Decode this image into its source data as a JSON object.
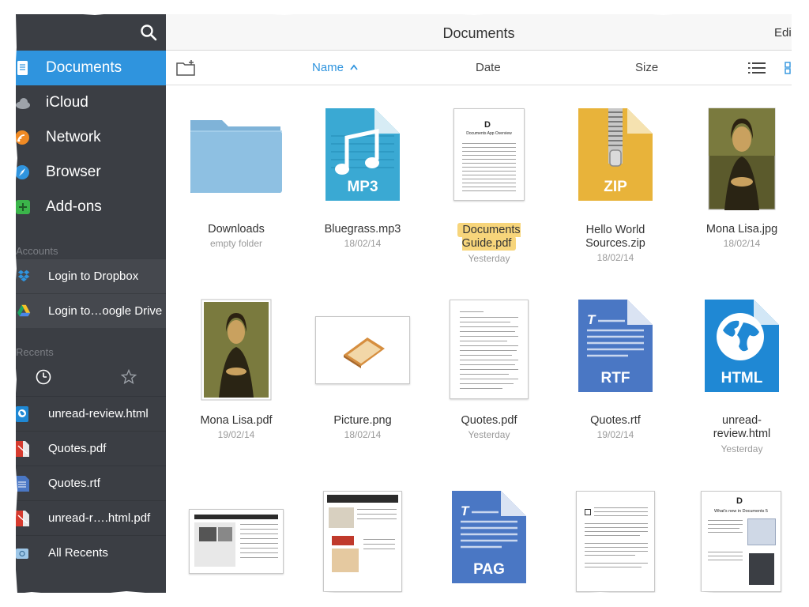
{
  "header": {
    "title": "Documents",
    "edit_label": "Edi"
  },
  "sidebar": {
    "items": [
      {
        "label": "Documents",
        "icon": "documents-icon",
        "active": true
      },
      {
        "label": "iCloud",
        "icon": "cloud-icon"
      },
      {
        "label": "Network",
        "icon": "network-icon"
      },
      {
        "label": "Browser",
        "icon": "compass-icon"
      },
      {
        "label": "Add-ons",
        "icon": "add-ons-icon"
      }
    ],
    "accounts_header": "Accounts",
    "accounts": [
      {
        "label": "Login to Dropbox",
        "icon": "dropbox-icon"
      },
      {
        "label": "Login to…oogle Drive",
        "icon": "google-drive-icon"
      }
    ],
    "recents_header": "Recents",
    "recents_tabs": [
      {
        "icon": "clock-icon"
      },
      {
        "icon": "star-icon"
      }
    ],
    "recents": [
      {
        "label": "unread-review.html",
        "icon": "html-file-icon"
      },
      {
        "label": "Quotes.pdf",
        "icon": "pdf-file-icon"
      },
      {
        "label": "Quotes.rtf",
        "icon": "rtf-file-icon"
      },
      {
        "label": "unread-r….html.pdf",
        "icon": "pdf-file-icon"
      },
      {
        "label": "All Recents",
        "icon": "all-recents-icon"
      }
    ]
  },
  "sort_bar": {
    "name_label": "Name",
    "date_label": "Date",
    "size_label": "Size",
    "active_sort": "Name"
  },
  "files": [
    {
      "name": "Downloads",
      "sub": "empty folder",
      "type": "folder"
    },
    {
      "name": "Bluegrass.mp3",
      "sub": "18/02/14",
      "type": "audio",
      "badge": "MP3"
    },
    {
      "name": "Documents Guide.pdf",
      "name_lines": [
        "Documents",
        "Guide.pdf"
      ],
      "sub": "Yesterday",
      "type": "pdf-doc",
      "highlighted": true
    },
    {
      "name": "Hello World Sources.zip",
      "name_lines": [
        "Hello World",
        "Sources.zip"
      ],
      "sub": "18/02/14",
      "type": "zip",
      "badge": "ZIP"
    },
    {
      "name": "Mona Lisa.jpg",
      "sub": "18/02/14",
      "type": "image"
    },
    {
      "name": "Mona Lisa.pdf",
      "sub": "19/02/14",
      "type": "image-pdf"
    },
    {
      "name": "Picture.png",
      "sub": "18/02/14",
      "type": "picture"
    },
    {
      "name": "Quotes.pdf",
      "sub": "Yesterday",
      "type": "text-pdf"
    },
    {
      "name": "Quotes.rtf",
      "sub": "19/02/14",
      "type": "rtf",
      "badge": "RTF"
    },
    {
      "name": "unread-review.html",
      "name_lines": [
        "unread-",
        "review.html"
      ],
      "sub": "Yesterday",
      "type": "html",
      "badge": "HTML"
    },
    {
      "name": "",
      "sub": "",
      "type": "web-pdf"
    },
    {
      "name": "",
      "sub": "",
      "type": "web-pdf-2"
    },
    {
      "name": "",
      "sub": "",
      "type": "pages",
      "badge": "PAG"
    },
    {
      "name": "",
      "sub": "",
      "type": "letter-pdf"
    },
    {
      "name": "",
      "sub": "",
      "type": "whats-new-pdf"
    }
  ],
  "thumb_text": {
    "guide_logo": "D",
    "guide_title": "Documents App Overview",
    "news_title": "What's new in Documents 5"
  },
  "colors": {
    "sidebar_bg": "#3b3e44",
    "accent": "#2f94de",
    "highlight": "#f7d57b",
    "mp3": "#3aa9d3",
    "zip": "#e8b33a",
    "rtf": "#4a77c4",
    "html": "#1f88d4"
  }
}
